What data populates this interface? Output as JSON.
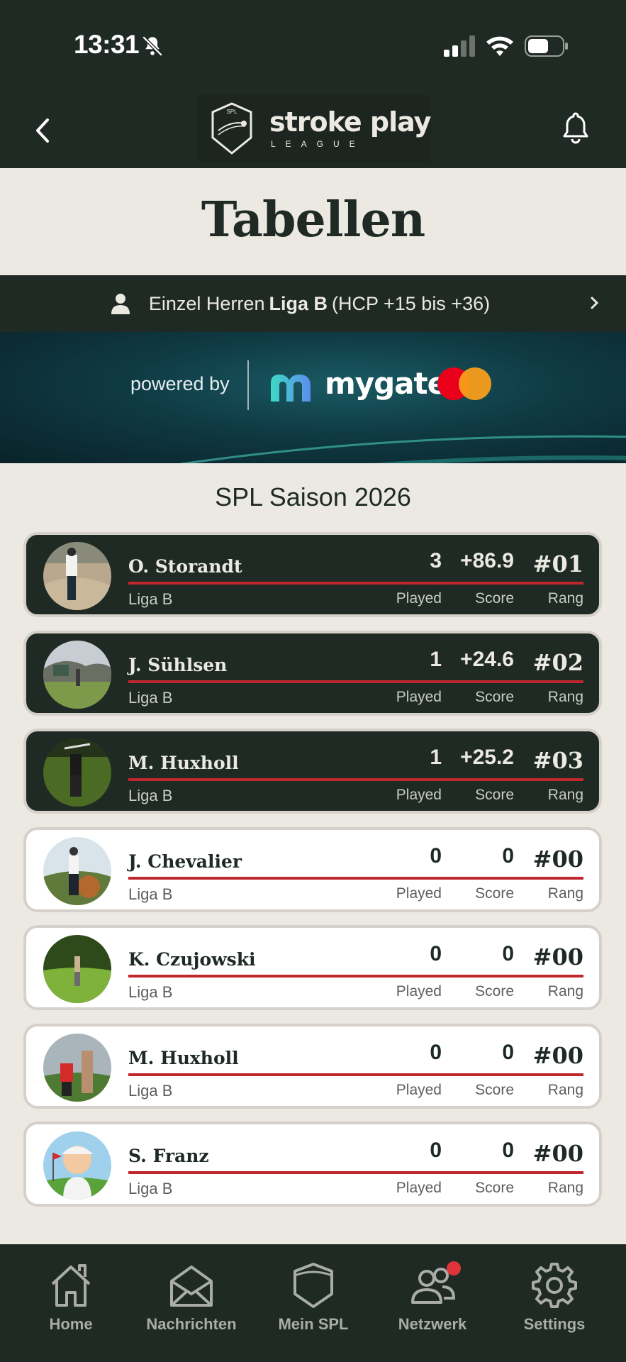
{
  "status": {
    "time": "13:31"
  },
  "header": {
    "logo_word": "stroke play",
    "logo_sub": "LEAGUE",
    "logo_badge": "SPL"
  },
  "page": {
    "title": "Tabellen"
  },
  "league_selector": {
    "prefix": "Einzel Herren",
    "league": "Liga B",
    "suffix": "(HCP +15 bis +36)"
  },
  "banner": {
    "powered_by": "powered by",
    "brand": "mygate"
  },
  "season": {
    "title": "SPL Saison 2026"
  },
  "labels": {
    "played": "Played",
    "score": "Score",
    "rank": "Rang"
  },
  "players": [
    {
      "name": "O. Storandt",
      "league": "Liga B",
      "played": "3",
      "score": "+86.9",
      "rank": "#01",
      "style": "dark"
    },
    {
      "name": "J. Sühlsen",
      "league": "Liga B",
      "played": "1",
      "score": "+24.6",
      "rank": "#02",
      "style": "dark"
    },
    {
      "name": "M. Huxholl",
      "league": "Liga B",
      "played": "1",
      "score": "+25.2",
      "rank": "#03",
      "style": "dark"
    },
    {
      "name": "J. Chevalier",
      "league": "Liga B",
      "played": "0",
      "score": "0",
      "rank": "#00",
      "style": "light"
    },
    {
      "name": "K. Czujowski",
      "league": "Liga B",
      "played": "0",
      "score": "0",
      "rank": "#00",
      "style": "light"
    },
    {
      "name": "M. Huxholl",
      "league": "Liga B",
      "played": "0",
      "score": "0",
      "rank": "#00",
      "style": "light"
    },
    {
      "name": "S. Franz",
      "league": "Liga B",
      "played": "0",
      "score": "0",
      "rank": "#00",
      "style": "light"
    }
  ],
  "tabs": [
    {
      "label": "Home",
      "icon": "home-icon"
    },
    {
      "label": "Nachrichten",
      "icon": "mail-icon"
    },
    {
      "label": "Mein SPL",
      "icon": "shield-icon"
    },
    {
      "label": "Netzwerk",
      "icon": "people-icon"
    },
    {
      "label": "Settings",
      "icon": "gear-icon"
    }
  ],
  "colors": {
    "dark": "#1f2a24",
    "background": "#ece9e3",
    "accent_red": "#c0272d",
    "badge_red": "#e0343b"
  }
}
